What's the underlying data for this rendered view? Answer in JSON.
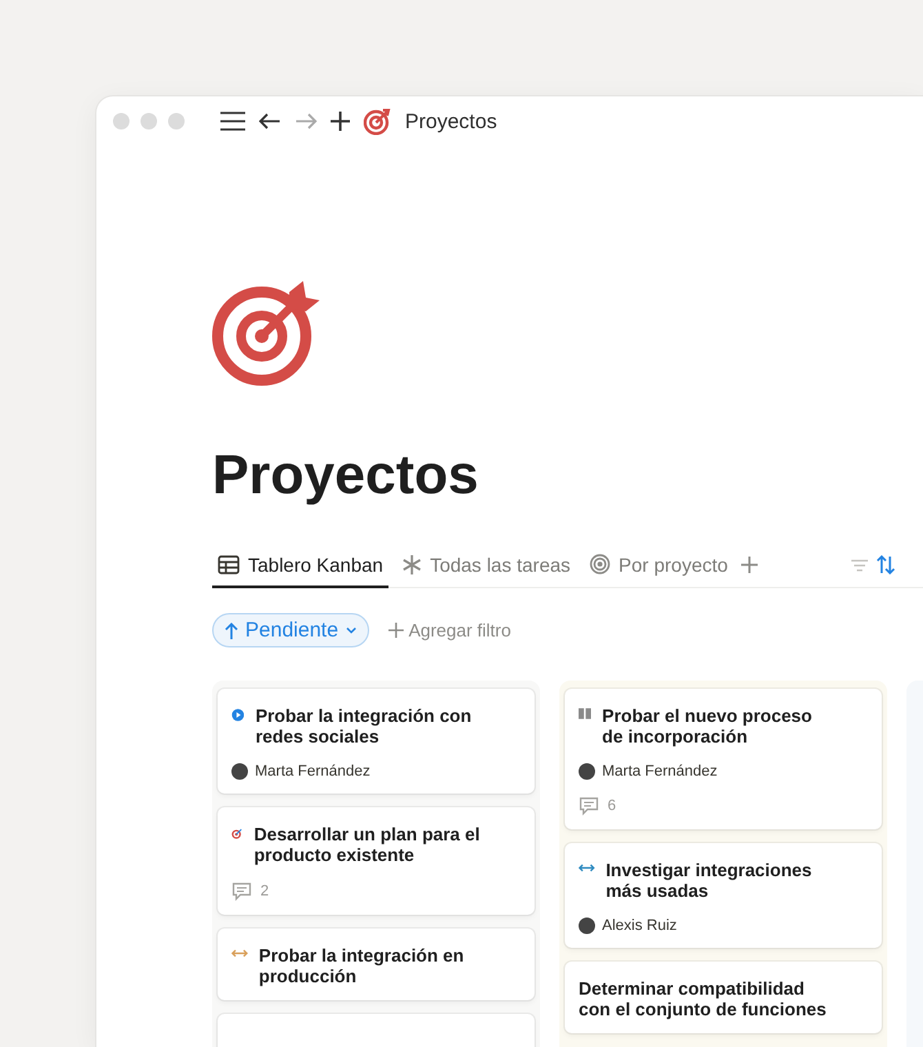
{
  "window": {
    "title": "Proyectos"
  },
  "page": {
    "title": "Proyectos"
  },
  "tabs": [
    {
      "label": "Tablero Kanban",
      "kind": "table",
      "selected": true
    },
    {
      "label": "Todas las tareas",
      "kind": "asterisk",
      "selected": false
    },
    {
      "label": "Por proyecto",
      "kind": "rings",
      "selected": false
    }
  ],
  "filter": {
    "label": "Pendiente",
    "add_label": "Agregar filtro"
  },
  "columns": [
    {
      "color": "#f8f8f7",
      "cards": [
        {
          "kind": "play",
          "color": "#2383e2",
          "title": "Probar la integración con redes sociales",
          "assignee": "Marta Fernández"
        },
        {
          "kind": "target",
          "color": "#d44c47",
          "title": "Desarrollar un plan para el producto existente",
          "comments": "2"
        },
        {
          "kind": "arrows",
          "color": "#d9a05b",
          "title": "Probar la integración en producción"
        },
        {
          "kind": "blank"
        }
      ]
    },
    {
      "color": "#fbf9f0",
      "cards": [
        {
          "kind": "book",
          "color": "#8a8a8a",
          "title": "Probar el nuevo proceso de incorporación",
          "assignee": "Marta Fernández",
          "comments": "6"
        },
        {
          "kind": "arrows",
          "color": "#2f8bc0",
          "title": "Investigar integraciones más usadas",
          "assignee": "Alexis Ruiz"
        },
        {
          "kind": "plain",
          "title": "Determinar compatibilidad con el conjunto de funciones"
        }
      ]
    },
    {
      "color": "#f5f8fb"
    }
  ]
}
